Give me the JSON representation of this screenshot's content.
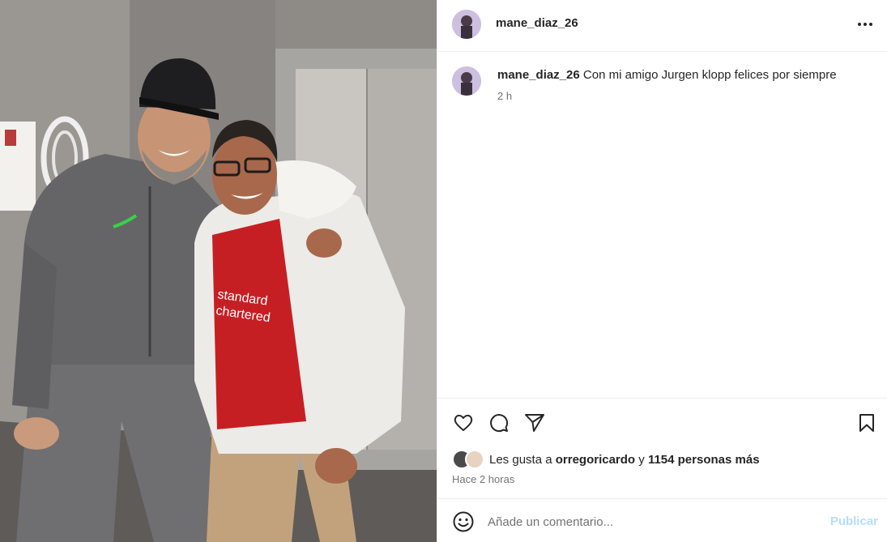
{
  "post": {
    "username": "mane_diaz_26",
    "more_icon": "more-horizontal-icon",
    "photo": {
      "description_icon": "photo",
      "shirt_text_line1": "standard",
      "shirt_text_line2": "chartered"
    },
    "caption": {
      "username": "mane_diaz_26",
      "text": "Con mi amigo Jurgen klopp felices por siempre",
      "time": "2 h"
    },
    "actions": {
      "like_icon": "heart-icon",
      "comment_icon": "comment-icon",
      "share_icon": "send-icon",
      "save_icon": "bookmark-icon"
    },
    "likes": {
      "prefix": "Les gusta a",
      "user": "orregoricardo",
      "connector": "y",
      "others": "1154 personas más"
    },
    "posted_ago": "Hace 2 horas",
    "comment": {
      "emoji_icon": "emoji-icon",
      "placeholder": "Añade un comentario...",
      "value": "",
      "publish_label": "Publicar"
    }
  },
  "colors": {
    "border": "#efefef",
    "text": "#262626",
    "secondary": "#737373",
    "publish_disabled": "#b2dffc"
  }
}
